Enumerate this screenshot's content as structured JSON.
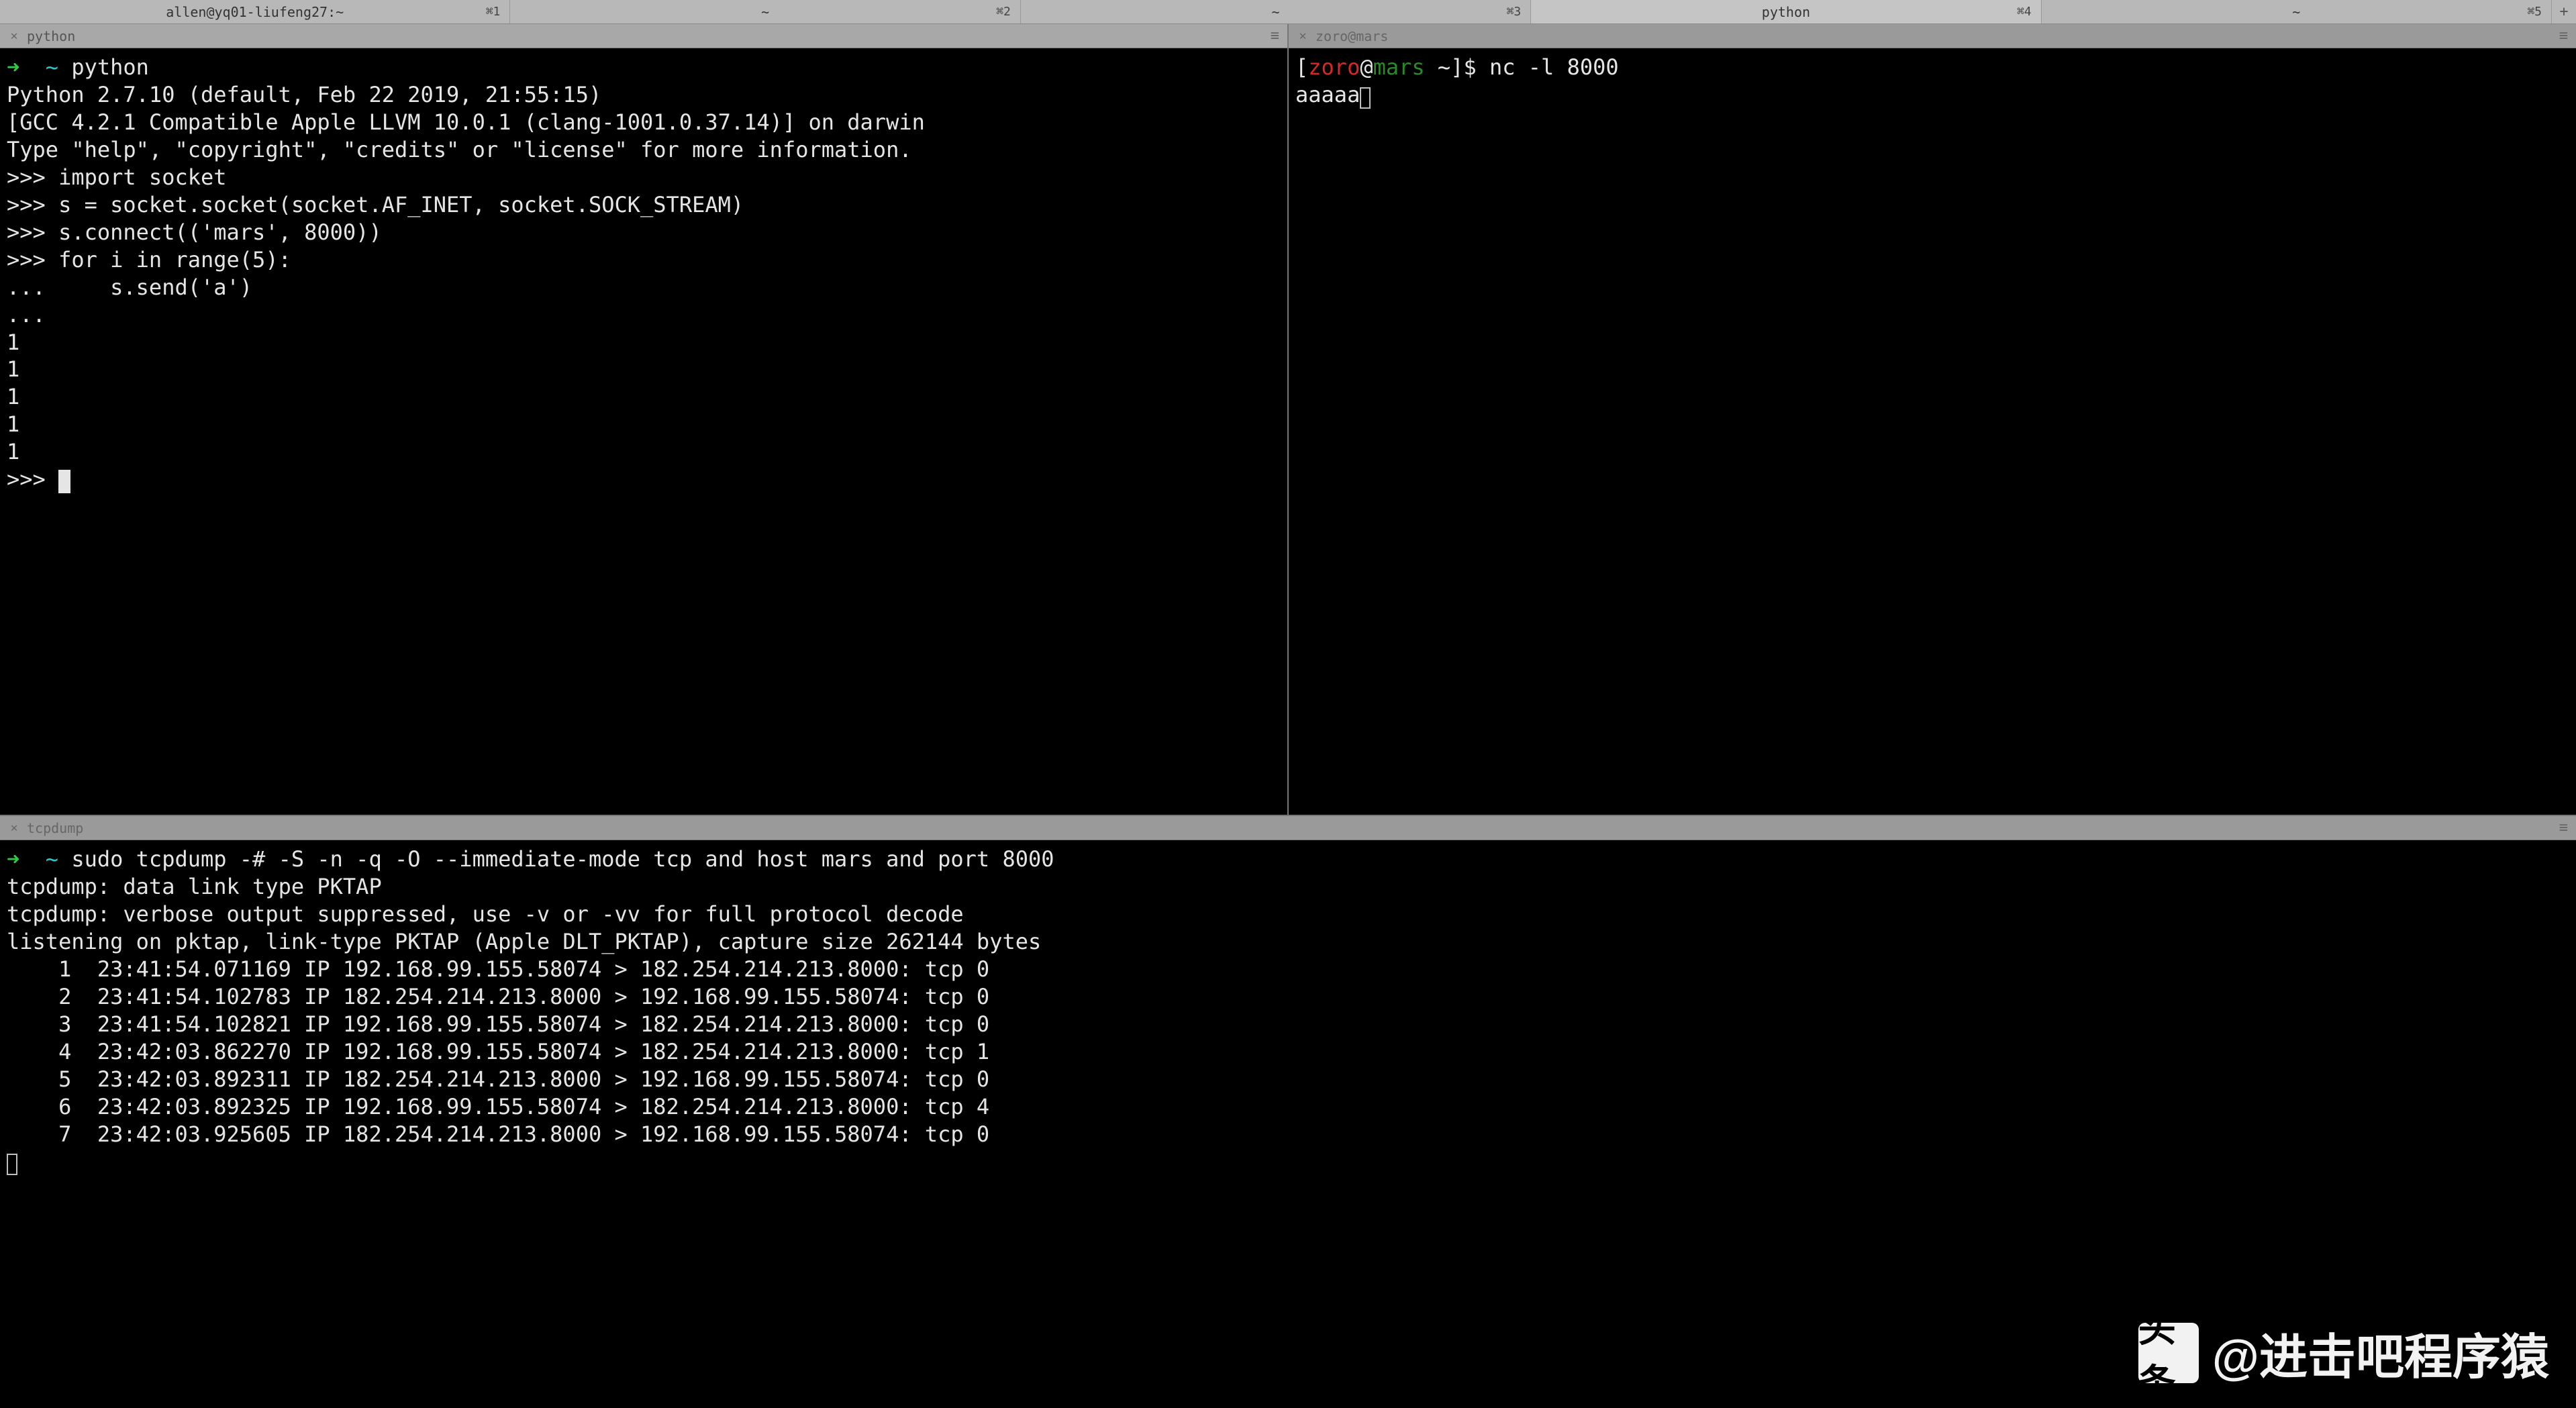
{
  "top_tabs": [
    {
      "label": "allen@yq01-liufeng27:~",
      "shortcut": "⌘1",
      "active": false
    },
    {
      "label": "~",
      "shortcut": "⌘2",
      "active": false
    },
    {
      "label": "~",
      "shortcut": "⌘3",
      "active": false
    },
    {
      "label": "python",
      "shortcut": "⌘4",
      "active": true
    },
    {
      "label": "~",
      "shortcut": "⌘5",
      "active": false
    }
  ],
  "panes": {
    "left": {
      "title": "python",
      "active": true
    },
    "right": {
      "title": "zoro@mars",
      "active": false
    },
    "bottom": {
      "title": "tcpdump",
      "active": false
    }
  },
  "left_term": {
    "prompt_arrow": "➜",
    "prompt_cwd": "~",
    "prompt_cmd": "python",
    "banner1": "Python 2.7.10 (default, Feb 22 2019, 21:55:15)",
    "banner2": "[GCC 4.2.1 Compatible Apple LLVM 10.0.1 (clang-1001.0.37.14)] on darwin",
    "banner3": "Type \"help\", \"copyright\", \"credits\" or \"license\" for more information.",
    "lines": [
      ">>> import socket",
      ">>> s = socket.socket(socket.AF_INET, socket.SOCK_STREAM)",
      ">>> s.connect(('mars', 8000))",
      ">>> for i in range(5):",
      "...     s.send('a')",
      "...",
      "1",
      "1",
      "1",
      "1",
      "1",
      ">>> "
    ]
  },
  "right_term": {
    "prompt_open": "[",
    "prompt_user": "zoro",
    "prompt_at": "@",
    "prompt_host": "mars",
    "prompt_rest": " ~]$ ",
    "prompt_cmd": "nc -l 8000",
    "output": "aaaaa"
  },
  "bottom_term": {
    "prompt_arrow": "➜",
    "prompt_cwd": "~",
    "cmd": "sudo tcpdump -# -S -n -q -O --immediate-mode tcp and host mars and port 8000",
    "pre1": "tcpdump: data link type PKTAP",
    "pre2": "tcpdump: verbose output suppressed, use -v or -vv for full protocol decode",
    "pre3": "listening on pktap, link-type PKTAP (Apple DLT_PKTAP), capture size 262144 bytes",
    "packets": [
      "    1  23:41:54.071169 IP 192.168.99.155.58074 > 182.254.214.213.8000: tcp 0",
      "    2  23:41:54.102783 IP 182.254.214.213.8000 > 192.168.99.155.58074: tcp 0",
      "    3  23:41:54.102821 IP 192.168.99.155.58074 > 182.254.214.213.8000: tcp 0",
      "    4  23:42:03.862270 IP 192.168.99.155.58074 > 182.254.214.213.8000: tcp 1",
      "    5  23:42:03.892311 IP 182.254.214.213.8000 > 192.168.99.155.58074: tcp 0",
      "    6  23:42:03.892325 IP 192.168.99.155.58074 > 182.254.214.213.8000: tcp 4",
      "    7  23:42:03.925605 IP 182.254.214.213.8000 > 192.168.99.155.58074: tcp 0"
    ]
  },
  "watermark": {
    "logo_text": "头条",
    "handle": "@进击吧程序猿"
  }
}
